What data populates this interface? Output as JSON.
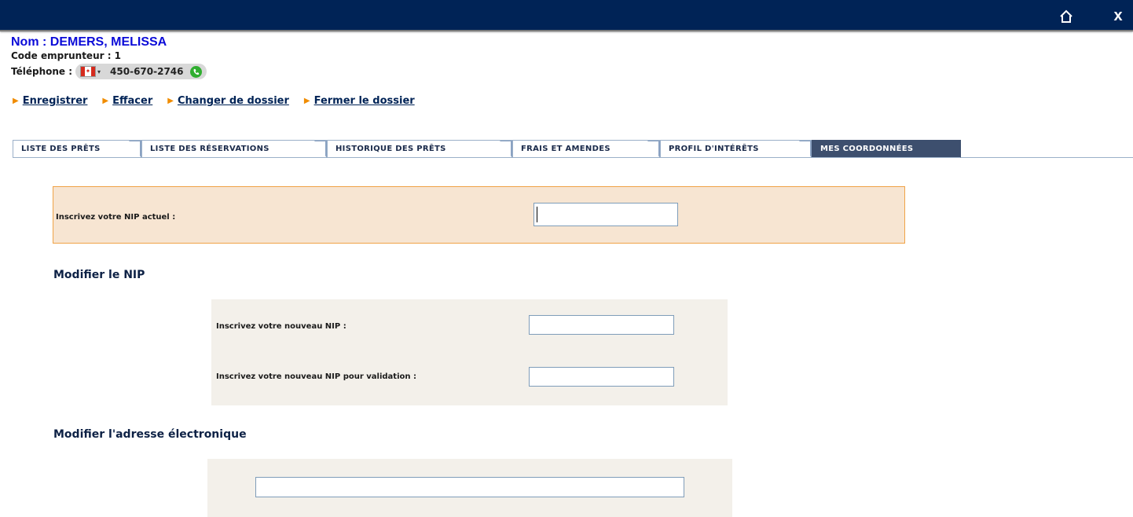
{
  "topbar": {
    "home_icon": "home-icon",
    "close_label": "x"
  },
  "patron": {
    "name": "Nom : DEMERS, MELISSA",
    "borrower_code": "Code emprunteur : 1",
    "phone_label": "Téléphone :",
    "phone_number": "450-670-2746",
    "country_flag": "canada-flag-icon",
    "call_icon": "call-icon"
  },
  "actions": [
    {
      "label": "Enregistrer"
    },
    {
      "label": "Effacer"
    },
    {
      "label": "Changer de dossier"
    },
    {
      "label": "Fermer le dossier"
    }
  ],
  "tabs": [
    {
      "label": "LISTE DES PRÊTS",
      "active": false
    },
    {
      "label": "LISTE DES RÉSERVATIONS",
      "active": false
    },
    {
      "label": "HISTORIQUE DES PRÊTS",
      "active": false
    },
    {
      "label": "FRAIS ET AMENDES",
      "active": false
    },
    {
      "label": "PROFIL D'INTÉRÊTS",
      "active": false
    },
    {
      "label": "MES COORDONNÉES",
      "active": true
    }
  ],
  "current_pin": {
    "label": "Inscrivez votre NIP actuel :",
    "value": ""
  },
  "modify_pin": {
    "title": "Modifier le NIP",
    "new_label": "Inscrivez votre nouveau NIP :",
    "new_value": "",
    "confirm_label": "Inscrivez votre nouveau NIP pour validation :",
    "confirm_value": ""
  },
  "modify_email": {
    "title": "Modifier l'adresse électronique",
    "value": ""
  },
  "colors": {
    "topbar": "#002356",
    "name": "#0b0bd8",
    "action_arrow": "#f08c00",
    "active_tab": "#3d4f6e",
    "current_pin_bg": "#f7e5d2",
    "current_pin_border": "#f0a347",
    "section_bg": "#f3f0ea"
  }
}
